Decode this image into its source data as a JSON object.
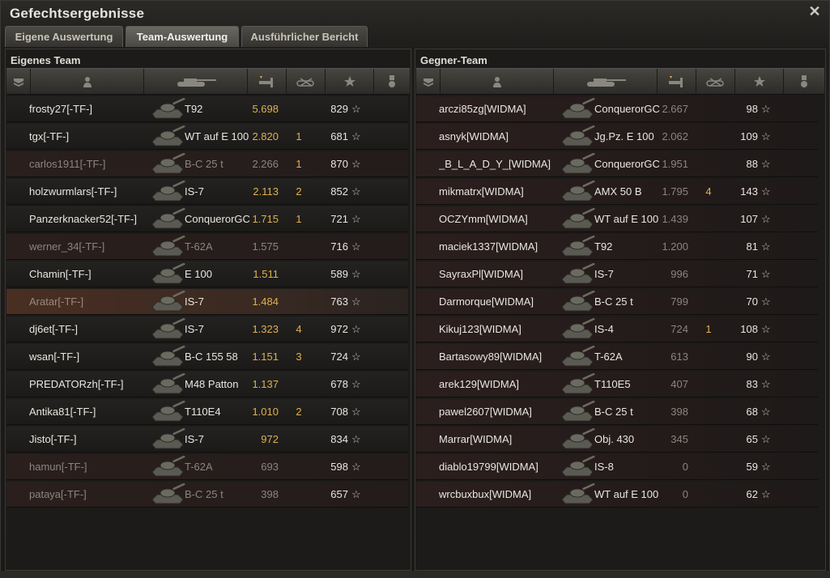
{
  "window": {
    "title": "Gefechtsergebnisse",
    "close": "✕"
  },
  "tabs": [
    {
      "label": "Eigene Auswertung",
      "active": false
    },
    {
      "label": "Team-Auswertung",
      "active": true
    },
    {
      "label": "Ausführlicher Bericht",
      "active": false
    }
  ],
  "own": {
    "title": "Eigenes Team",
    "rows": [
      {
        "name": "frosty27[-TF-]",
        "tank": "T92",
        "xp": "5.698",
        "kills": "",
        "score": "829",
        "state": "alive"
      },
      {
        "name": "tgx[-TF-]",
        "tank": "WT auf E 100",
        "xp": "2.820",
        "kills": "1",
        "score": "681",
        "state": "alive"
      },
      {
        "name": "carlos1911[-TF-]",
        "tank": "B-C 25 t",
        "xp": "2.266",
        "kills": "1",
        "score": "870",
        "state": "dead"
      },
      {
        "name": "holzwurmlars[-TF-]",
        "tank": "IS-7",
        "xp": "2.113",
        "kills": "2",
        "score": "852",
        "state": "alive"
      },
      {
        "name": "Panzerknacker52[-TF-]",
        "tank": "ConquerorGC",
        "xp": "1.715",
        "kills": "1",
        "score": "721",
        "state": "alive"
      },
      {
        "name": "werner_34[-TF-]",
        "tank": "T-62A",
        "xp": "1.575",
        "kills": "",
        "score": "716",
        "state": "dead"
      },
      {
        "name": "Chamin[-TF-]",
        "tank": "E 100",
        "xp": "1.511",
        "kills": "",
        "score": "589",
        "state": "alive"
      },
      {
        "name": "Aratar[-TF-]",
        "tank": "IS-7",
        "xp": "1.484",
        "kills": "",
        "score": "763",
        "state": "self"
      },
      {
        "name": "dj6et[-TF-]",
        "tank": "IS-7",
        "xp": "1.323",
        "kills": "4",
        "score": "972",
        "state": "alive"
      },
      {
        "name": "wsan[-TF-]",
        "tank": "B-C 155 58",
        "xp": "1.151",
        "kills": "3",
        "score": "724",
        "state": "alive"
      },
      {
        "name": "PREDATORzh[-TF-]",
        "tank": "M48 Patton",
        "xp": "1.137",
        "kills": "",
        "score": "678",
        "state": "alive"
      },
      {
        "name": "Antika81[-TF-]",
        "tank": "T110E4",
        "xp": "1.010",
        "kills": "2",
        "score": "708",
        "state": "alive"
      },
      {
        "name": "Jisto[-TF-]",
        "tank": "IS-7",
        "xp": "972",
        "kills": "",
        "score": "834",
        "state": "alive"
      },
      {
        "name": "hamun[-TF-]",
        "tank": "T-62A",
        "xp": "693",
        "kills": "",
        "score": "598",
        "state": "dead"
      },
      {
        "name": "pataya[-TF-]",
        "tank": "B-C 25 t",
        "xp": "398",
        "kills": "",
        "score": "657",
        "state": "dead"
      }
    ]
  },
  "enemy": {
    "title": "Gegner-Team",
    "rows": [
      {
        "name": "arczi85zg[WIDMA]",
        "tank": "ConquerorGC",
        "xp": "2.667",
        "kills": "",
        "score": "98"
      },
      {
        "name": "asnyk[WIDMA]",
        "tank": "Jg.Pz. E 100",
        "xp": "2.062",
        "kills": "",
        "score": "109"
      },
      {
        "name": "_B_L_A_D_Y_[WIDMA]",
        "tank": "ConquerorGC",
        "xp": "1.951",
        "kills": "",
        "score": "88"
      },
      {
        "name": "mikmatrx[WIDMA]",
        "tank": "AMX 50 B",
        "xp": "1.795",
        "kills": "4",
        "score": "143"
      },
      {
        "name": "OCZYmm[WIDMA]",
        "tank": "WT auf E 100",
        "xp": "1.439",
        "kills": "",
        "score": "107"
      },
      {
        "name": "maciek1337[WIDMA]",
        "tank": "T92",
        "xp": "1.200",
        "kills": "",
        "score": "81"
      },
      {
        "name": "SayraxPl[WIDMA]",
        "tank": "IS-7",
        "xp": "996",
        "kills": "",
        "score": "71"
      },
      {
        "name": "Darmorque[WIDMA]",
        "tank": "B-C 25 t",
        "xp": "799",
        "kills": "",
        "score": "70"
      },
      {
        "name": "Kikuj123[WIDMA]",
        "tank": "IS-4",
        "xp": "724",
        "kills": "1",
        "score": "108"
      },
      {
        "name": "Bartasowy89[WIDMA]",
        "tank": "T-62A",
        "xp": "613",
        "kills": "",
        "score": "90"
      },
      {
        "name": "arek129[WIDMA]",
        "tank": "T110E5",
        "xp": "407",
        "kills": "",
        "score": "83"
      },
      {
        "name": "pawel2607[WIDMA]",
        "tank": "B-C 25 t",
        "xp": "398",
        "kills": "",
        "score": "68"
      },
      {
        "name": "Marrar[WIDMA]",
        "tank": "Obj. 430",
        "xp": "345",
        "kills": "",
        "score": "65"
      },
      {
        "name": "diablo19799[WIDMA]",
        "tank": "IS-8",
        "xp": "0",
        "kills": "",
        "score": "59"
      },
      {
        "name": "wrcbuxbux[WIDMA]",
        "tank": "WT auf E 100",
        "xp": "0",
        "kills": "",
        "score": "62"
      }
    ]
  },
  "star": "☆",
  "colors": {
    "xp": "#e0b050",
    "kills": "#e0b050",
    "dead_row": "#2a1f1d",
    "self_row": "#4a2e22"
  },
  "header_icons": [
    "platoon-icon",
    "player-icon",
    "tank-icon",
    "damage-icon",
    "kills-icon",
    "medal-star-icon",
    "achievement-icon"
  ]
}
